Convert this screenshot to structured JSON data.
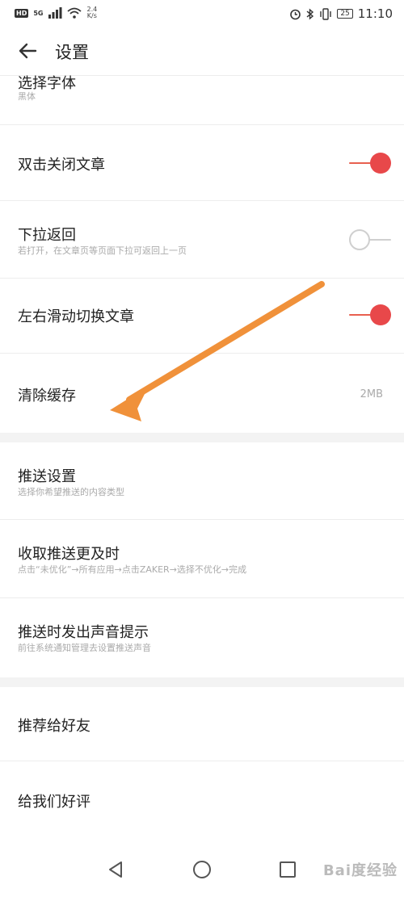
{
  "status_bar": {
    "hd": "HD",
    "network_type": "5G",
    "net_rate_value": "2.4",
    "net_rate_unit": "K/s",
    "battery": "25",
    "time": "11:10"
  },
  "header": {
    "title": "设置"
  },
  "settings": {
    "font": {
      "label": "选择字体",
      "sub": "黑体"
    },
    "double_tap_close": {
      "label": "双击关闭文章",
      "enabled": true
    },
    "pull_down_back": {
      "label": "下拉返回",
      "sub": "若打开，在文章页等页面下拉可返回上一页",
      "enabled": false
    },
    "swipe_switch": {
      "label": "左右滑动切换文章",
      "enabled": true
    },
    "clear_cache": {
      "label": "清除缓存",
      "value": "2MB"
    },
    "push_settings": {
      "label": "推送设置",
      "sub": "选择你希望推送的内容类型"
    },
    "push_timely": {
      "label": "收取推送更及时",
      "sub": "点击“未优化”→所有应用→点击ZAKER→选择不优化→完成"
    },
    "push_sound": {
      "label": "推送时发出声音提示",
      "sub": "前往系统通知管理去设置推送声音"
    },
    "recommend": {
      "label": "推荐给好友"
    },
    "rate_us": {
      "label": "给我们好评"
    }
  },
  "colors": {
    "toggle_on": "#e8484a",
    "toggle_off": "#cfcfcf",
    "annotation_arrow": "#f0913a"
  },
  "icons": {
    "back": "arrow-left-icon",
    "nav_back": "triangle-back-icon",
    "nav_home": "circle-home-icon",
    "nav_recents": "square-recents-icon"
  },
  "watermark": "Bai度经验"
}
